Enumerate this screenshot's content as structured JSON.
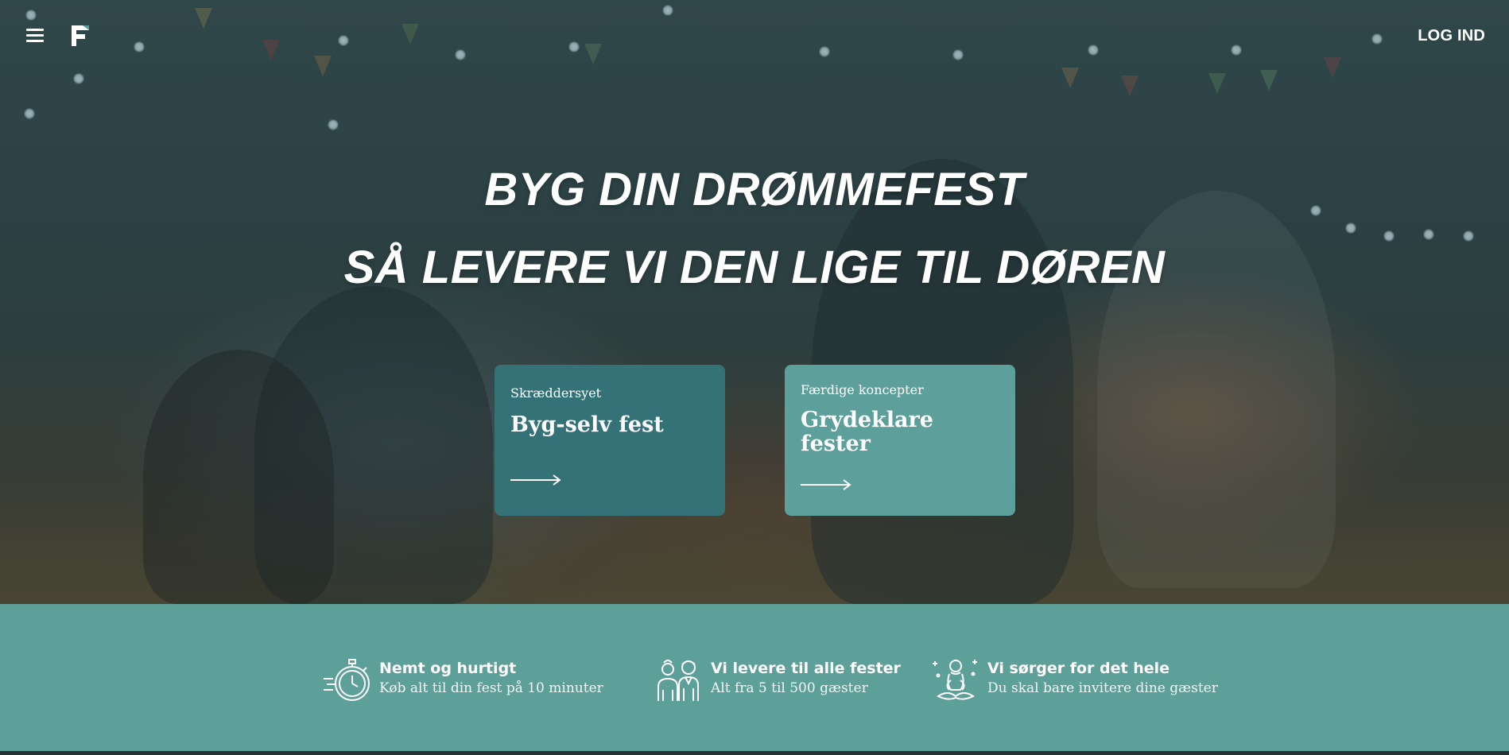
{
  "header": {
    "menu_icon": "hamburger-menu-icon",
    "logo_icon": "f-logo-icon",
    "login_label": "LOG IND"
  },
  "hero": {
    "headline_line1": "BYG DIN DRØMMEFEST",
    "headline_line2": "SÅ LEVERE VI DEN LIGE TIL DØREN"
  },
  "cards": [
    {
      "subtitle": "Skræddersyet",
      "title": "Byg-selv fest",
      "icon": "arrow-right-icon",
      "color": "#357278"
    },
    {
      "subtitle": "Færdige koncepter",
      "title": "Grydeklare fester",
      "icon": "arrow-right-icon",
      "color": "#5d9f9a"
    }
  ],
  "features": [
    {
      "icon": "stopwatch-icon",
      "title": "Nemt og hurtigt",
      "description": "Køb alt til din fest på 10 minuter"
    },
    {
      "icon": "people-icon",
      "title": "Vi levere til alle fester",
      "description": "Alt fra 5 til 500 gæster"
    },
    {
      "icon": "meditation-icon",
      "title": "Vi sørger for det hele",
      "description": "Du skal bare invitere dine gæster"
    }
  ],
  "colors": {
    "card_dark": "#357278",
    "card_light": "#5d9f9a",
    "features_band": "#5d9f99"
  }
}
